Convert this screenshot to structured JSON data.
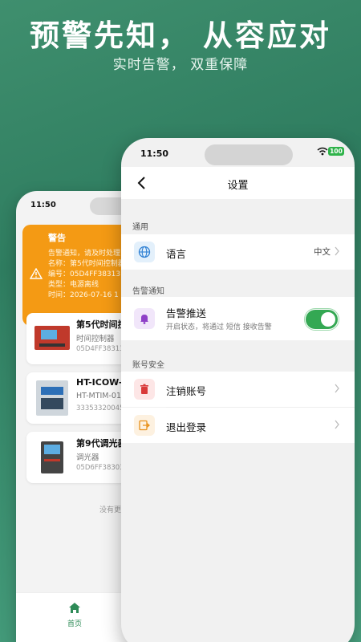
{
  "promo": {
    "headline": "预警先知，  从容应对",
    "subline": "实时告警，  双重保障"
  },
  "back_screen": {
    "status_time": "11:50",
    "alert": {
      "title": "警告",
      "lines": [
        "告警通知，请及时处理",
        "名称：第5代时间控制器",
        "编号：05D4FF38313",
        "类型：电源离线",
        "时间：2026-07-16 1"
      ]
    },
    "devices": [
      {
        "name": "第5代时间控",
        "type": "时间控制器",
        "id": "05D4FF38313"
      },
      {
        "name": "HT-ICOW-",
        "type": "HT-MTIM-01",
        "id": "33353320045"
      },
      {
        "name": "第9代调光器",
        "type": "调光器",
        "id": "05D6FF38303"
      }
    ],
    "no_more": "没有更多",
    "tab_home_label": "首页"
  },
  "settings": {
    "status_time": "11:50",
    "battery": "100",
    "title": "设置",
    "section_general": "通用",
    "language_label": "语言",
    "language_value": "中文",
    "section_alarm": "告警通知",
    "push_label": "告警推送",
    "push_desc": "开启状态，将通过 短信 接收告警",
    "push_enabled": true,
    "section_account": "账号安全",
    "cancel_account_label": "注销账号",
    "logout_label": "退出登录"
  },
  "colors": {
    "accent_green": "#34a853",
    "alert_orange": "#f49a14",
    "bg_green": "#3f8f6e"
  }
}
